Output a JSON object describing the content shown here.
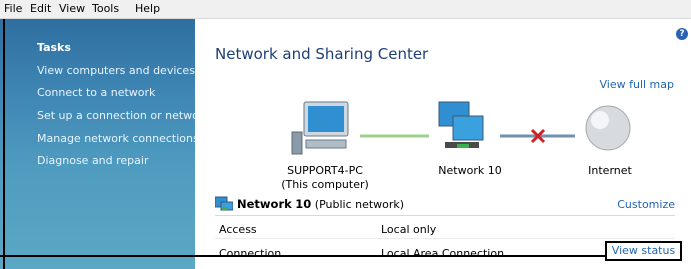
{
  "menu": [
    "File",
    "Edit",
    "View",
    "Tools",
    "Help"
  ],
  "sidebar": {
    "heading": "Tasks",
    "items": [
      "View computers and devices",
      "Connect to a network",
      "Set up a connection or network",
      "Manage network connections",
      "Diagnose and repair"
    ]
  },
  "main": {
    "title": "Network and Sharing Center",
    "help_glyph": "?",
    "view_full_map": "View full map",
    "map": {
      "computer_name": "SUPPORT4-PC",
      "computer_note": "(This computer)",
      "network_name": "Network 10",
      "internet_label": "Internet",
      "internet_link_status": "disconnected"
    },
    "network": {
      "name": "Network",
      "number": "10",
      "type": "(Public network)",
      "customize": "Customize",
      "rows": [
        {
          "label": "Access",
          "value": "Local only"
        },
        {
          "label": "Connection",
          "value": "Local Area Connection"
        }
      ],
      "view_status": "View status"
    }
  },
  "colors": {
    "sidebar_top": "#2e6fa0",
    "sidebar_bottom": "#5aa8c4",
    "link": "#2165b0",
    "title": "#1e3f78",
    "error_x": "#d42020",
    "connector_ok": "#9ad08a"
  }
}
